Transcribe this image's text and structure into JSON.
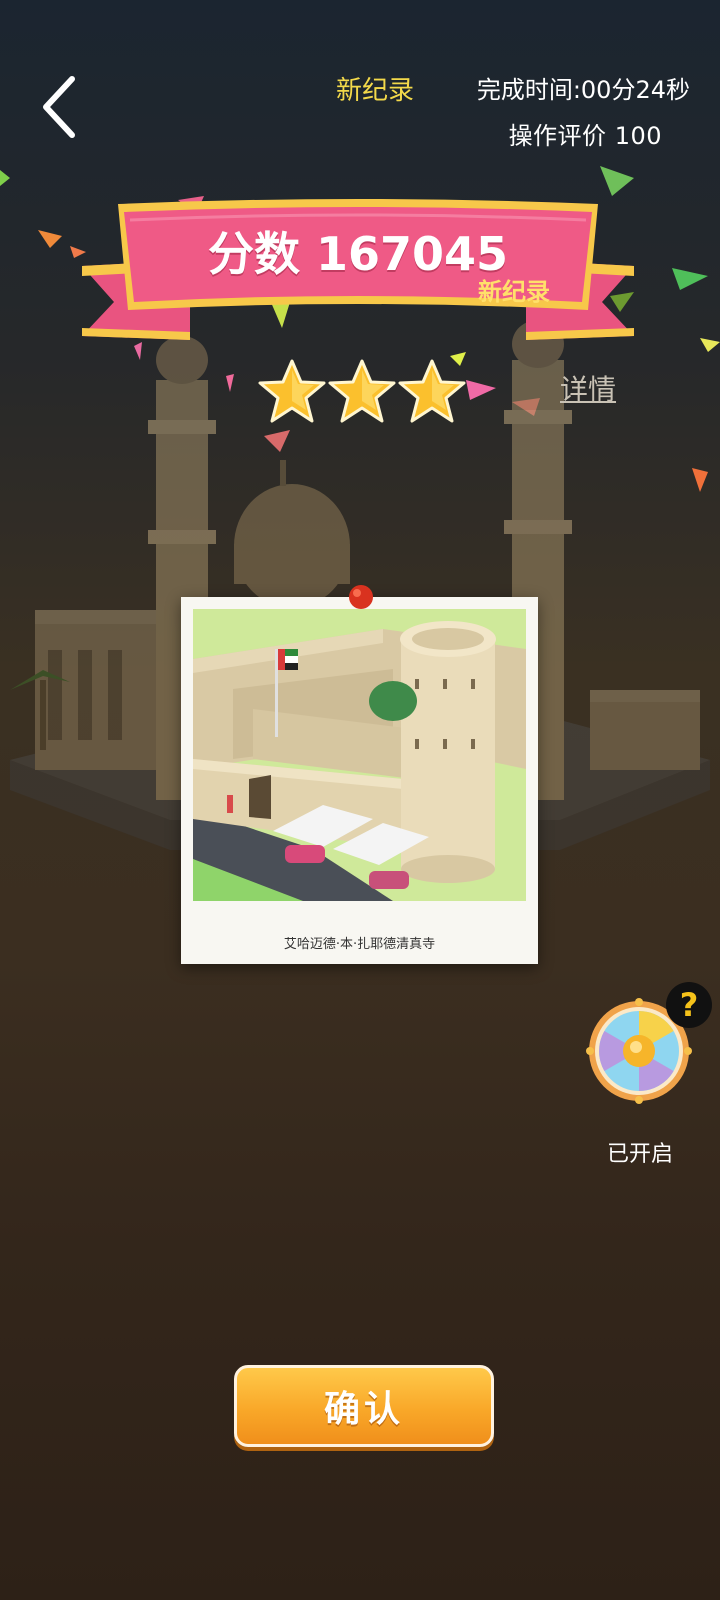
{
  "header": {
    "new_record": "新纪录",
    "finish_time": "完成时间:00分24秒",
    "op_rating": "操作评价  100"
  },
  "banner": {
    "score": "分数 167045",
    "new_record": "新纪录"
  },
  "stars": {
    "earned": 3,
    "total": 3
  },
  "details_label": "详情",
  "photo": {
    "caption": "艾哈迈德·本·扎耶德清真寺"
  },
  "wheel": {
    "help_symbol": "?",
    "status": "已开启"
  },
  "confirm_label": "确认",
  "colors": {
    "banner_pink": "#ef5a86",
    "banner_gold": "#f7c84a",
    "new_record": "#f3d94a",
    "button_orange": "#f9a829",
    "star_gold": "#fbc02d"
  },
  "icons": {
    "back": "chevron-left-icon",
    "star": "star-icon",
    "help": "question-icon",
    "wheel": "lucky-wheel-icon",
    "pin": "pushpin-icon"
  }
}
